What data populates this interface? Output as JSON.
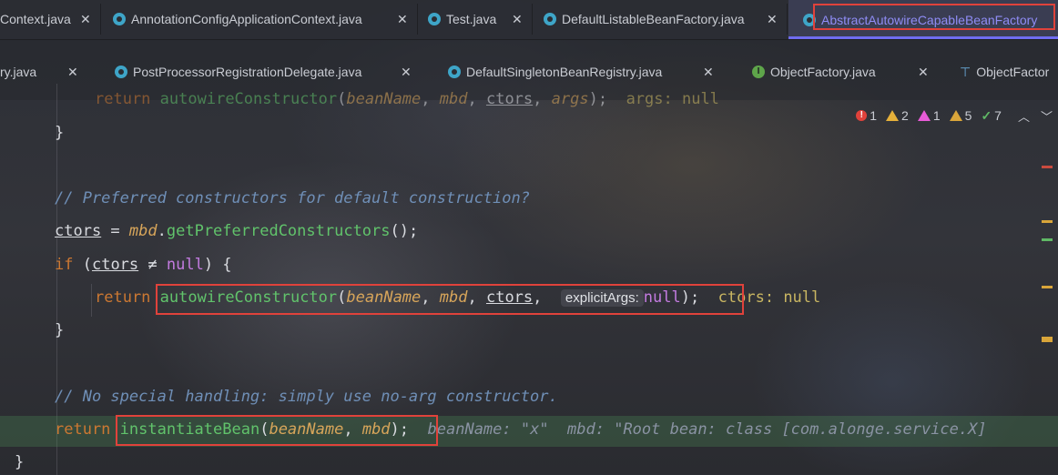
{
  "tabs_row1": [
    {
      "label": "Context.java",
      "icon": "none"
    },
    {
      "label": "AnnotationConfigApplicationContext.java",
      "icon": "class-icon"
    },
    {
      "label": "Test.java",
      "icon": "class-icon"
    },
    {
      "label": "DefaultListableBeanFactory.java",
      "icon": "class-icon"
    },
    {
      "label": "AbstractAutowireCapableBeanFactory",
      "icon": "class-icon",
      "active": true
    }
  ],
  "tabs_row2": [
    {
      "label": "ry.java",
      "icon": "none"
    },
    {
      "label": "PostProcessorRegistrationDelegate.java",
      "icon": "class-icon"
    },
    {
      "label": "DefaultSingletonBeanRegistry.java",
      "icon": "class-icon"
    },
    {
      "label": "ObjectFactory.java",
      "icon": "interface-icon"
    },
    {
      "label": "ObjectFactor",
      "icon": "hierarchy-icon"
    }
  ],
  "inspections": {
    "errors": "1",
    "warnings": "2",
    "weak_warnings": "1",
    "typos": "5",
    "ok": "7"
  },
  "code": {
    "l0": {
      "kw": "return",
      "fn": "autowireConstructor",
      "open": "(",
      "p1": "beanName",
      "sep1": ", ",
      "p2": "mbd",
      "sep2": ", ",
      "p3": "ctors",
      "sep3": ", ",
      "p4": "args",
      "close": ");",
      "hint": "args: null"
    },
    "l1": {
      "brace": "}"
    },
    "l2": {
      "comment": "// Preferred constructors for default construction?"
    },
    "l3": {
      "var": "ctors",
      "eq": " = ",
      "recv": "mbd",
      "dot": ".",
      "call": "getPreferredConstructors",
      "tail": "();"
    },
    "l4": {
      "kw": "if",
      "open": " (",
      "var": "ctors",
      "op": " ≠ ",
      "nul": "null",
      "tail": ") {"
    },
    "l5": {
      "kw": "return",
      "fn": "autowireConstructor",
      "open": "(",
      "p1": "beanName",
      "sep1": ", ",
      "p2": "mbd",
      "sep2": ", ",
      "p3": "ctors",
      "sep3": ", ",
      "hint_label": "explicitArgs:",
      "nul": "null",
      "close": ");",
      "inline": "ctors: null"
    },
    "l6": {
      "brace": "}"
    },
    "l7": {
      "comment": "// No special handling: simply use no-arg constructor."
    },
    "l8": {
      "kw": "return",
      "fn": "instantiateBean",
      "open": "(",
      "p1": "beanName",
      "sep1": ", ",
      "p2": "mbd",
      "close": ");",
      "inline": "beanName: \"x\"  mbd: \"Root bean: class [com.alonge.service.X]"
    },
    "l9": {
      "brace": "}"
    }
  },
  "colors": {
    "highlight_box": "#e0423b",
    "keyword": "#cc7832",
    "method": "#61c36b",
    "param": "#d7a55a",
    "comment": "#6f8fb7",
    "active_tab_text": "#8f8cf5"
  }
}
